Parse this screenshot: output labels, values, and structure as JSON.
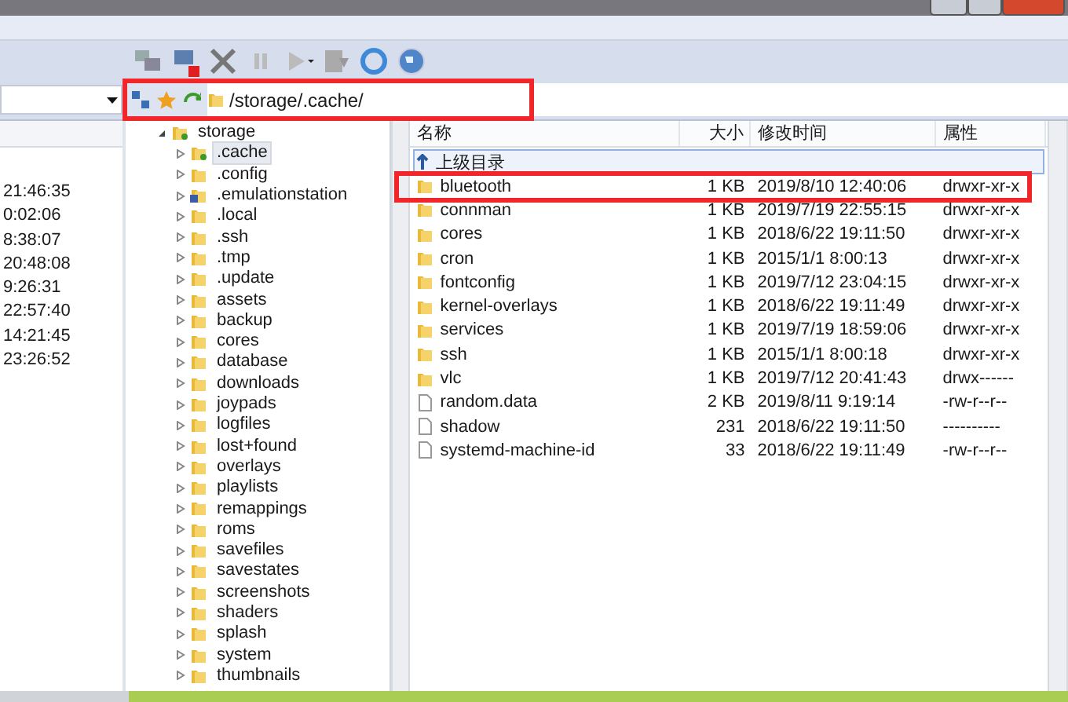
{
  "address_bar": {
    "path": "/storage/.cache/",
    "highlighted": true
  },
  "left_pane": {
    "times": [
      "21:46:35",
      "0:02:06",
      "8:38:07",
      "20:48:08",
      "9:26:31",
      "22:57:40",
      "14:21:45",
      "23:26:52"
    ]
  },
  "tree": {
    "label": "storage",
    "expanded": true,
    "children": [
      {
        "label": ".cache",
        "selected": true,
        "kind": "linked"
      },
      {
        "label": ".config",
        "selected": false,
        "kind": "folder"
      },
      {
        "label": ".emulationstation",
        "selected": false,
        "kind": "mounted"
      },
      {
        "label": ".local",
        "selected": false,
        "kind": "folder"
      },
      {
        "label": ".ssh",
        "selected": false,
        "kind": "folder"
      },
      {
        "label": ".tmp",
        "selected": false,
        "kind": "folder"
      },
      {
        "label": ".update",
        "selected": false,
        "kind": "folder"
      },
      {
        "label": "assets",
        "selected": false,
        "kind": "folder"
      },
      {
        "label": "backup",
        "selected": false,
        "kind": "folder"
      },
      {
        "label": "cores",
        "selected": false,
        "kind": "folder"
      },
      {
        "label": "database",
        "selected": false,
        "kind": "folder"
      },
      {
        "label": "downloads",
        "selected": false,
        "kind": "folder"
      },
      {
        "label": "joypads",
        "selected": false,
        "kind": "folder"
      },
      {
        "label": "logfiles",
        "selected": false,
        "kind": "folder"
      },
      {
        "label": "lost+found",
        "selected": false,
        "kind": "folder"
      },
      {
        "label": "overlays",
        "selected": false,
        "kind": "folder"
      },
      {
        "label": "playlists",
        "selected": false,
        "kind": "folder"
      },
      {
        "label": "remappings",
        "selected": false,
        "kind": "folder"
      },
      {
        "label": "roms",
        "selected": false,
        "kind": "folder"
      },
      {
        "label": "savefiles",
        "selected": false,
        "kind": "folder"
      },
      {
        "label": "savestates",
        "selected": false,
        "kind": "folder"
      },
      {
        "label": "screenshots",
        "selected": false,
        "kind": "folder"
      },
      {
        "label": "shaders",
        "selected": false,
        "kind": "folder"
      },
      {
        "label": "splash",
        "selected": false,
        "kind": "folder"
      },
      {
        "label": "system",
        "selected": false,
        "kind": "folder"
      },
      {
        "label": "thumbnails",
        "selected": false,
        "kind": "folder"
      }
    ]
  },
  "file_list": {
    "columns": [
      "名称",
      "大小",
      "修改时间",
      "属性"
    ],
    "parent_row": "上级目录",
    "rows": [
      {
        "kind": "folder",
        "name": "bluetooth",
        "size": "1 KB",
        "modified": "2019/8/10 12:40:06",
        "attributes": "drwxr-xr-x",
        "highlighted": true
      },
      {
        "kind": "folder",
        "name": "connman",
        "size": "1 KB",
        "modified": "2019/7/19 22:55:15",
        "attributes": "drwxr-xr-x",
        "highlighted": false
      },
      {
        "kind": "folder",
        "name": "cores",
        "size": "1 KB",
        "modified": "2018/6/22 19:11:50",
        "attributes": "drwxr-xr-x",
        "highlighted": false
      },
      {
        "kind": "folder",
        "name": "cron",
        "size": "1 KB",
        "modified": "2015/1/1 8:00:13",
        "attributes": "drwxr-xr-x",
        "highlighted": false
      },
      {
        "kind": "folder",
        "name": "fontconfig",
        "size": "1 KB",
        "modified": "2019/7/12 23:04:15",
        "attributes": "drwxr-xr-x",
        "highlighted": false
      },
      {
        "kind": "folder",
        "name": "kernel-overlays",
        "size": "1 KB",
        "modified": "2018/6/22 19:11:49",
        "attributes": "drwxr-xr-x",
        "highlighted": false
      },
      {
        "kind": "folder",
        "name": "services",
        "size": "1 KB",
        "modified": "2019/7/19 18:59:06",
        "attributes": "drwxr-xr-x",
        "highlighted": false
      },
      {
        "kind": "folder",
        "name": "ssh",
        "size": "1 KB",
        "modified": "2015/1/1 8:00:18",
        "attributes": "drwxr-xr-x",
        "highlighted": false
      },
      {
        "kind": "folder",
        "name": "vlc",
        "size": "1 KB",
        "modified": "2019/7/12 20:41:43",
        "attributes": "drwx------",
        "highlighted": false
      },
      {
        "kind": "file",
        "name": "random.data",
        "size": "2 KB",
        "modified": "2019/8/11 9:19:14",
        "attributes": "-rw-r--r--",
        "highlighted": false
      },
      {
        "kind": "file",
        "name": "shadow",
        "size": "231",
        "modified": "2018/6/22 19:11:50",
        "attributes": "----------",
        "highlighted": false
      },
      {
        "kind": "file",
        "name": "systemd-machine-id",
        "size": "33",
        "modified": "2018/6/22 19:11:49",
        "attributes": "-rw-r--r--",
        "highlighted": false
      }
    ]
  }
}
